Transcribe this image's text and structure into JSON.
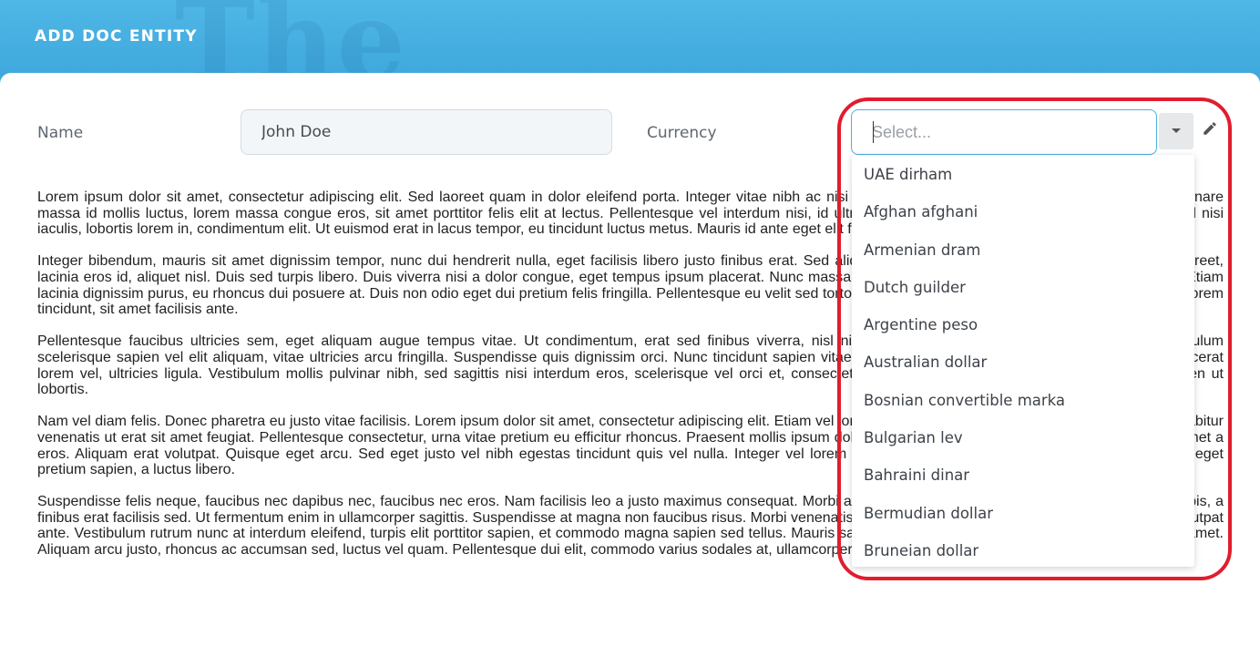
{
  "header": {
    "title": "ADD DOC ENTITY",
    "watermark": "The"
  },
  "form": {
    "name_label": "Name",
    "name_value": "John Doe",
    "currency_label": "Currency",
    "currency_placeholder": "Select...",
    "currency_value": ""
  },
  "icons": {
    "dropdown": "caret-down-icon",
    "edit": "pencil-icon"
  },
  "currency_options": [
    "UAE dirham",
    "Afghan afghani",
    "Armenian dram",
    "Dutch guilder",
    "Argentine peso",
    "Australian dollar",
    "Bosnian convertible marka",
    "Bulgarian lev",
    "Bahraini dinar",
    "Bermudian dollar",
    "Bruneian dollar"
  ],
  "colors": {
    "header_blue": "#45b0e2",
    "focus_border": "#4aaee0",
    "highlight_red": "#e11d2e"
  },
  "body_paragraphs": [
    "Lorem ipsum dolor sit amet, consectetur adipiscing elit. Sed laoreet quam in dolor eleifend porta. Integer vitae nibh ac nisi fermentum pretium. Integer ut luctus nisi. Nullam ornare massa id mollis luctus, lorem massa congue eros, sit amet porttitor felis elit at lectus. Pellentesque vel interdum nisi, id ultrices velit. Ut ac purus elementum gravida. Fusce id nisi iaculis, lobortis lorem in, condimentum elit. Ut euismod erat in lacus tempor, eu tincidunt luctus metus. Mauris id ante eget elit facilisis sagittis pulvinar ut risus.",
    "Integer bibendum, mauris sit amet dignissim tempor, nunc dui hendrerit nulla, eget facilisis libero justo finibus erat. Sed aliquam nisl vitae sollicitudin. Praesent vitae purus laoreet, lacinia eros id, aliquet nisl. Duis sed turpis libero. Duis viverra nisi a dolor congue, eget tempus ipsum placerat. Nunc massa sed felis suscipit, nec commodo turpis sollicitudin. Etiam lacinia dignissim purus, eu rhoncus dui posuere at. Duis non odio eget dui pretium felis fringilla. Pellentesque eu velit sed tortor congue rhoncus. Pellentesque bibendum felis nec lorem tincidunt, sit amet facilisis ante.",
    "Pellentesque faucibus ultricies sem, eget aliquam augue tempus vitae. Ut condimentum, erat sed finibus viverra, nisl nibh tristique dolor, sed luctus est vel purus. Vestibulum scelerisque sapien vel elit aliquam, vitae ultricies arcu fringilla. Suspendisse quis dignissim orci. Nunc tincidunt sapien vitae massa feugiat. Quisque sit amet metus lacinia, placerat lorem vel, ultricies ligula. Vestibulum mollis pulvinar nibh, sed sagittis nisi interdum eros, scelerisque vel orci et, consectetur malesuada ipsum. Quisque blandit congue sapien ut lobortis.",
    "Nam vel diam felis. Donec pharetra eu justo vitae facilisis. Lorem ipsum dolor sit amet, consectetur adipiscing elit. Etiam vel lorem sit amet. Donec porta id neque sed fringilla. Curabitur venenatis ut erat sit amet feugiat. Pellentesque consectetur, urna vitae pretium eu efficitur rhoncus. Praesent mollis ipsum dolor. Fusce gravida lectus vel elit auctor ultricies sit amet a eros. Aliquam erat volutpat. Quisque eget arcu. Sed eget justo vel nibh egestas tincidunt quis vel nulla. Integer vel lorem semper, rhoncus urna nec, vivamus ultricies. Nunc eget pretium sapien, a luctus libero.",
    "Suspendisse felis neque, faucibus nec dapibus nec, faucibus nec eros. Nam facilisis leo a justo maximus consequat. Morbi aliquam egestas sagittis. Quisque egestas massa turpis, a finibus erat facilisis sed. Ut fermentum enim in ullamcorper sagittis. Suspendisse at magna non faucibus risus. Morbi venenatis rutrum ante, id facilisis nulla laoreet a. Nunc non volutpat ante. Vestibulum rutrum nunc at interdum eleifend, turpis elit porttitor sapien, et commodo magna sapien sed tellus. Mauris sagittis nulla mauris, a posuere neque elementum sit amet. Aliquam arcu justo, rhoncus ac accumsan sed, luctus vel quam. Pellentesque dui elit, commodo varius sodales at, ullamcorper posuere leo."
  ]
}
